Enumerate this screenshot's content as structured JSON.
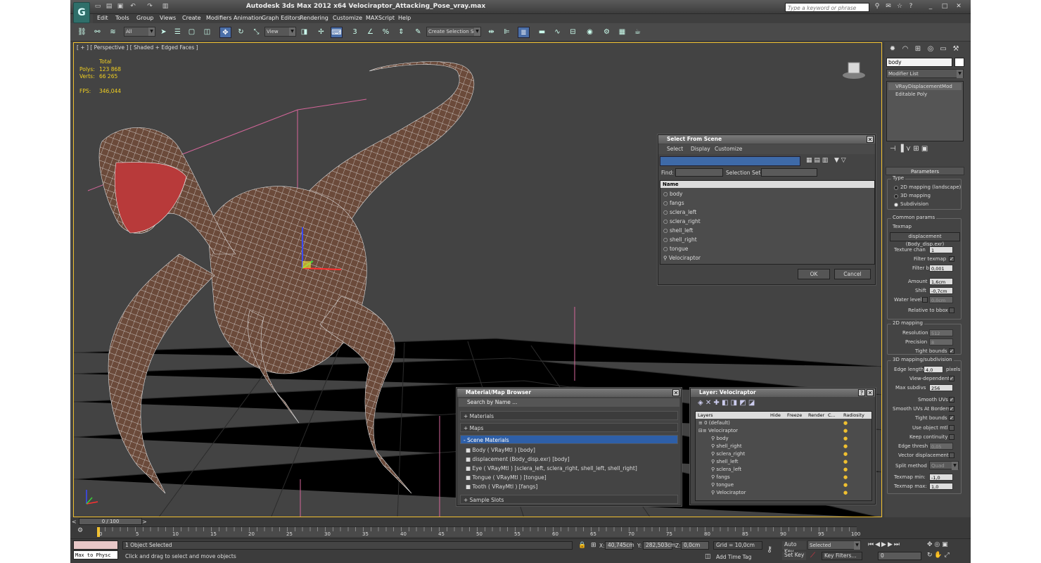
{
  "app": {
    "title": "Autodesk 3ds Max  2012 x64      Velociraptor_Attacking_Pose_vray.max",
    "search_placeholder": "Type a keyword or phrase"
  },
  "menus": [
    "Edit",
    "Tools",
    "Group",
    "Views",
    "Create",
    "Modifiers",
    "Animation",
    "Graph Editors",
    "Rendering",
    "Customize",
    "MAXScript",
    "Help"
  ],
  "toolbar": {
    "filter_select": "All",
    "coord_select": "View",
    "selection_set_placeholder": "Create Selection Se"
  },
  "viewport": {
    "label": "[ + ] [ Perspective ] [ Shaded + Edged Faces ]",
    "stats_header": "Total",
    "polys_label": "Polys:",
    "polys_value": "123 868",
    "verts_label": "Verts:",
    "verts_value": "66 265",
    "fps_label": "FPS:",
    "fps_value": "346,044"
  },
  "command_panel": {
    "object_name": "body",
    "modifier_list": "Modifier List",
    "stack": [
      "VRayDisplacementMod",
      "Editable Poly"
    ],
    "parameters_title": "Parameters",
    "type_group": "Type",
    "type_options": [
      "2D mapping (landscape)",
      "3D mapping",
      "Subdivision"
    ],
    "type_selected": 2,
    "common_group": "Common params",
    "texmap_label": "Texmap",
    "texmap_value": "displacement (Body_disp.exr)",
    "texture_chan_label": "Texture chan",
    "texture_chan_value": "1",
    "filter_texmap_label": "Filter texmap",
    "filter_blur_label": "Filter blur",
    "filter_blur_value": "0,001",
    "amount_label": "Amount",
    "amount_value": "1,6cm",
    "shift_label": "Shift",
    "shift_value": "-0,7cm",
    "water_label": "Water level",
    "water_value": "0,0cm",
    "relative_label": "Relative to bbox",
    "map2d_group": "2D mapping",
    "resolution_label": "Resolution",
    "resolution_value": "512",
    "precision_label": "Precision",
    "precision_value": "8",
    "tight2d_label": "Tight bounds",
    "map3d_group": "3D mapping/subdivision",
    "edge_len_label": "Edge length",
    "edge_len_value": "4,0",
    "pixels_label": "pixels",
    "view_dep_label": "View-dependent",
    "max_subdivs_label": "Max subdivs",
    "max_subdivs_value": "256",
    "smooth_uvs_label": "Smooth UVs",
    "smooth_borders_label": "Smooth UVs At Borders",
    "tight3d_label": "Tight bounds",
    "use_obj_mtl_label": "Use object mtl",
    "keep_cont_label": "Keep continuity",
    "edge_thresh_label": "Edge thresh",
    "edge_thresh_value": "0,05",
    "vector_disp_label": "Vector displacement",
    "split_label": "Split method",
    "split_value": "Quad",
    "texmap_min_label": "Texmap min:",
    "texmap_min_value": "-1,0",
    "texmap_max_label": "Texmap max:",
    "texmap_max_value": "1,0"
  },
  "select_dialog": {
    "title": "Select From Scene",
    "menus": [
      "Select",
      "Display",
      "Customize"
    ],
    "find_label": "Find:",
    "selset_label": "Selection Set:",
    "column": "Name",
    "items": [
      "body",
      "fangs",
      "sclera_left",
      "sclera_right",
      "shell_left",
      "shell_right",
      "tongue",
      "Velociraptor"
    ],
    "ok": "OK",
    "cancel": "Cancel"
  },
  "material_browser": {
    "title": "Material/Map Browser",
    "search_placeholder": "Search by Name ...",
    "sections": [
      "+ Materials",
      "+ Maps",
      "- Scene Materials"
    ],
    "items": [
      "Body  ( VRayMtl )  [body]",
      "displacement (Body_disp.exr) [body]",
      "Eye  ( VRayMtl )  [sclera_left, sclera_right, shell_left, shell_right]",
      "Tongue  ( VRayMtl )  [tongue]",
      "Tooth  ( VRayMtl )  [fangs]"
    ],
    "sample_slots": "+ Sample Slots"
  },
  "layer_dialog": {
    "title": "Layer: Velociraptor",
    "help": "?",
    "columns": [
      "Layers",
      "Hide",
      "Freeze",
      "Render",
      "C...",
      "Radiosity"
    ],
    "rows": [
      "0 (default)",
      "Velociraptor",
      "body",
      "shell_right",
      "sclera_right",
      "shell_left",
      "sclera_left",
      "fangs",
      "tongue",
      "Velociraptor"
    ]
  },
  "timeline": {
    "frame": "0 / 100",
    "ticks": [
      "0",
      "5",
      "10",
      "15",
      "20",
      "25",
      "30",
      "35",
      "40",
      "45",
      "50",
      "55",
      "60",
      "65",
      "70",
      "75",
      "80",
      "85",
      "90",
      "95",
      "100"
    ]
  },
  "status": {
    "maxscript": "Max to Physc",
    "selected": "1 Object Selected",
    "prompt": "Click and drag to select and move objects",
    "x_label": "X:",
    "x_value": "40,745cm",
    "y_label": "Y:",
    "y_value": "282,503cm",
    "z_label": "Z:",
    "z_value": "0,0cm",
    "grid": "Grid = 10,0cm",
    "add_time_tag": "Add Time Tag",
    "auto_key": "Auto Key",
    "set_key": "Set Key",
    "selected_dd": "Selected",
    "key_filters": "Key Filters...",
    "frame_field": "0"
  },
  "colors": {
    "viewport_border": "#f0c030",
    "stats": "#f2d020",
    "selected_rollout": "#2e5fa8"
  }
}
